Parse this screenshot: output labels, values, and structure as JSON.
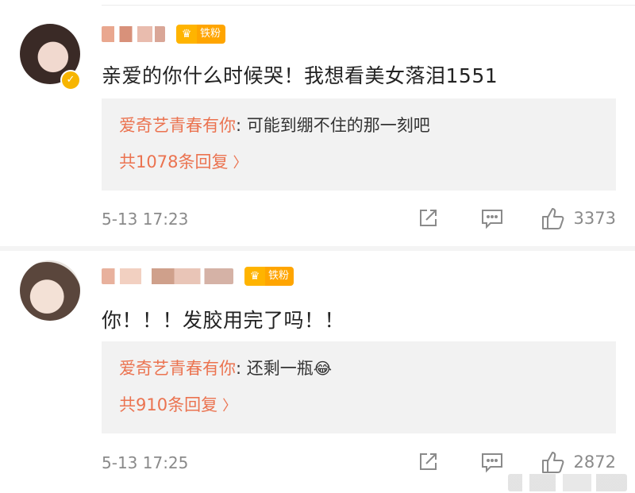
{
  "comments": [
    {
      "fan_badge": "铁粉",
      "content": "亲爱的你什么时候哭！我想看美女落泪1551",
      "reply": {
        "author": "爱奇艺青春有你",
        "text": ": 可能到绷不住的那一刻吧",
        "emoji": ""
      },
      "reply_count_label": "共1078条回复",
      "time": "5-13 17:23",
      "likes": "3373",
      "verified": true
    },
    {
      "fan_badge": "铁粉",
      "content": "你！！！发胶用完了吗！！",
      "reply": {
        "author": "爱奇艺青春有你",
        "text": ": 还剩一瓶",
        "emoji": "😂"
      },
      "reply_count_label": "共910条回复",
      "time": "5-13 17:25",
      "likes": "2872",
      "verified": false
    }
  ],
  "icons": {
    "repost": "repost-icon",
    "comment": "comment-icon",
    "like": "like-icon",
    "chevron": "chevron-right-icon",
    "crown": "crown-icon"
  },
  "colors": {
    "accent": "#eb7350",
    "badge": "#ffa500",
    "reply_bg": "#f2f2f2",
    "meta": "#8a8a8a"
  },
  "glyphs": {
    "chevron": "〉",
    "crown": "♛",
    "verified": "✓"
  }
}
